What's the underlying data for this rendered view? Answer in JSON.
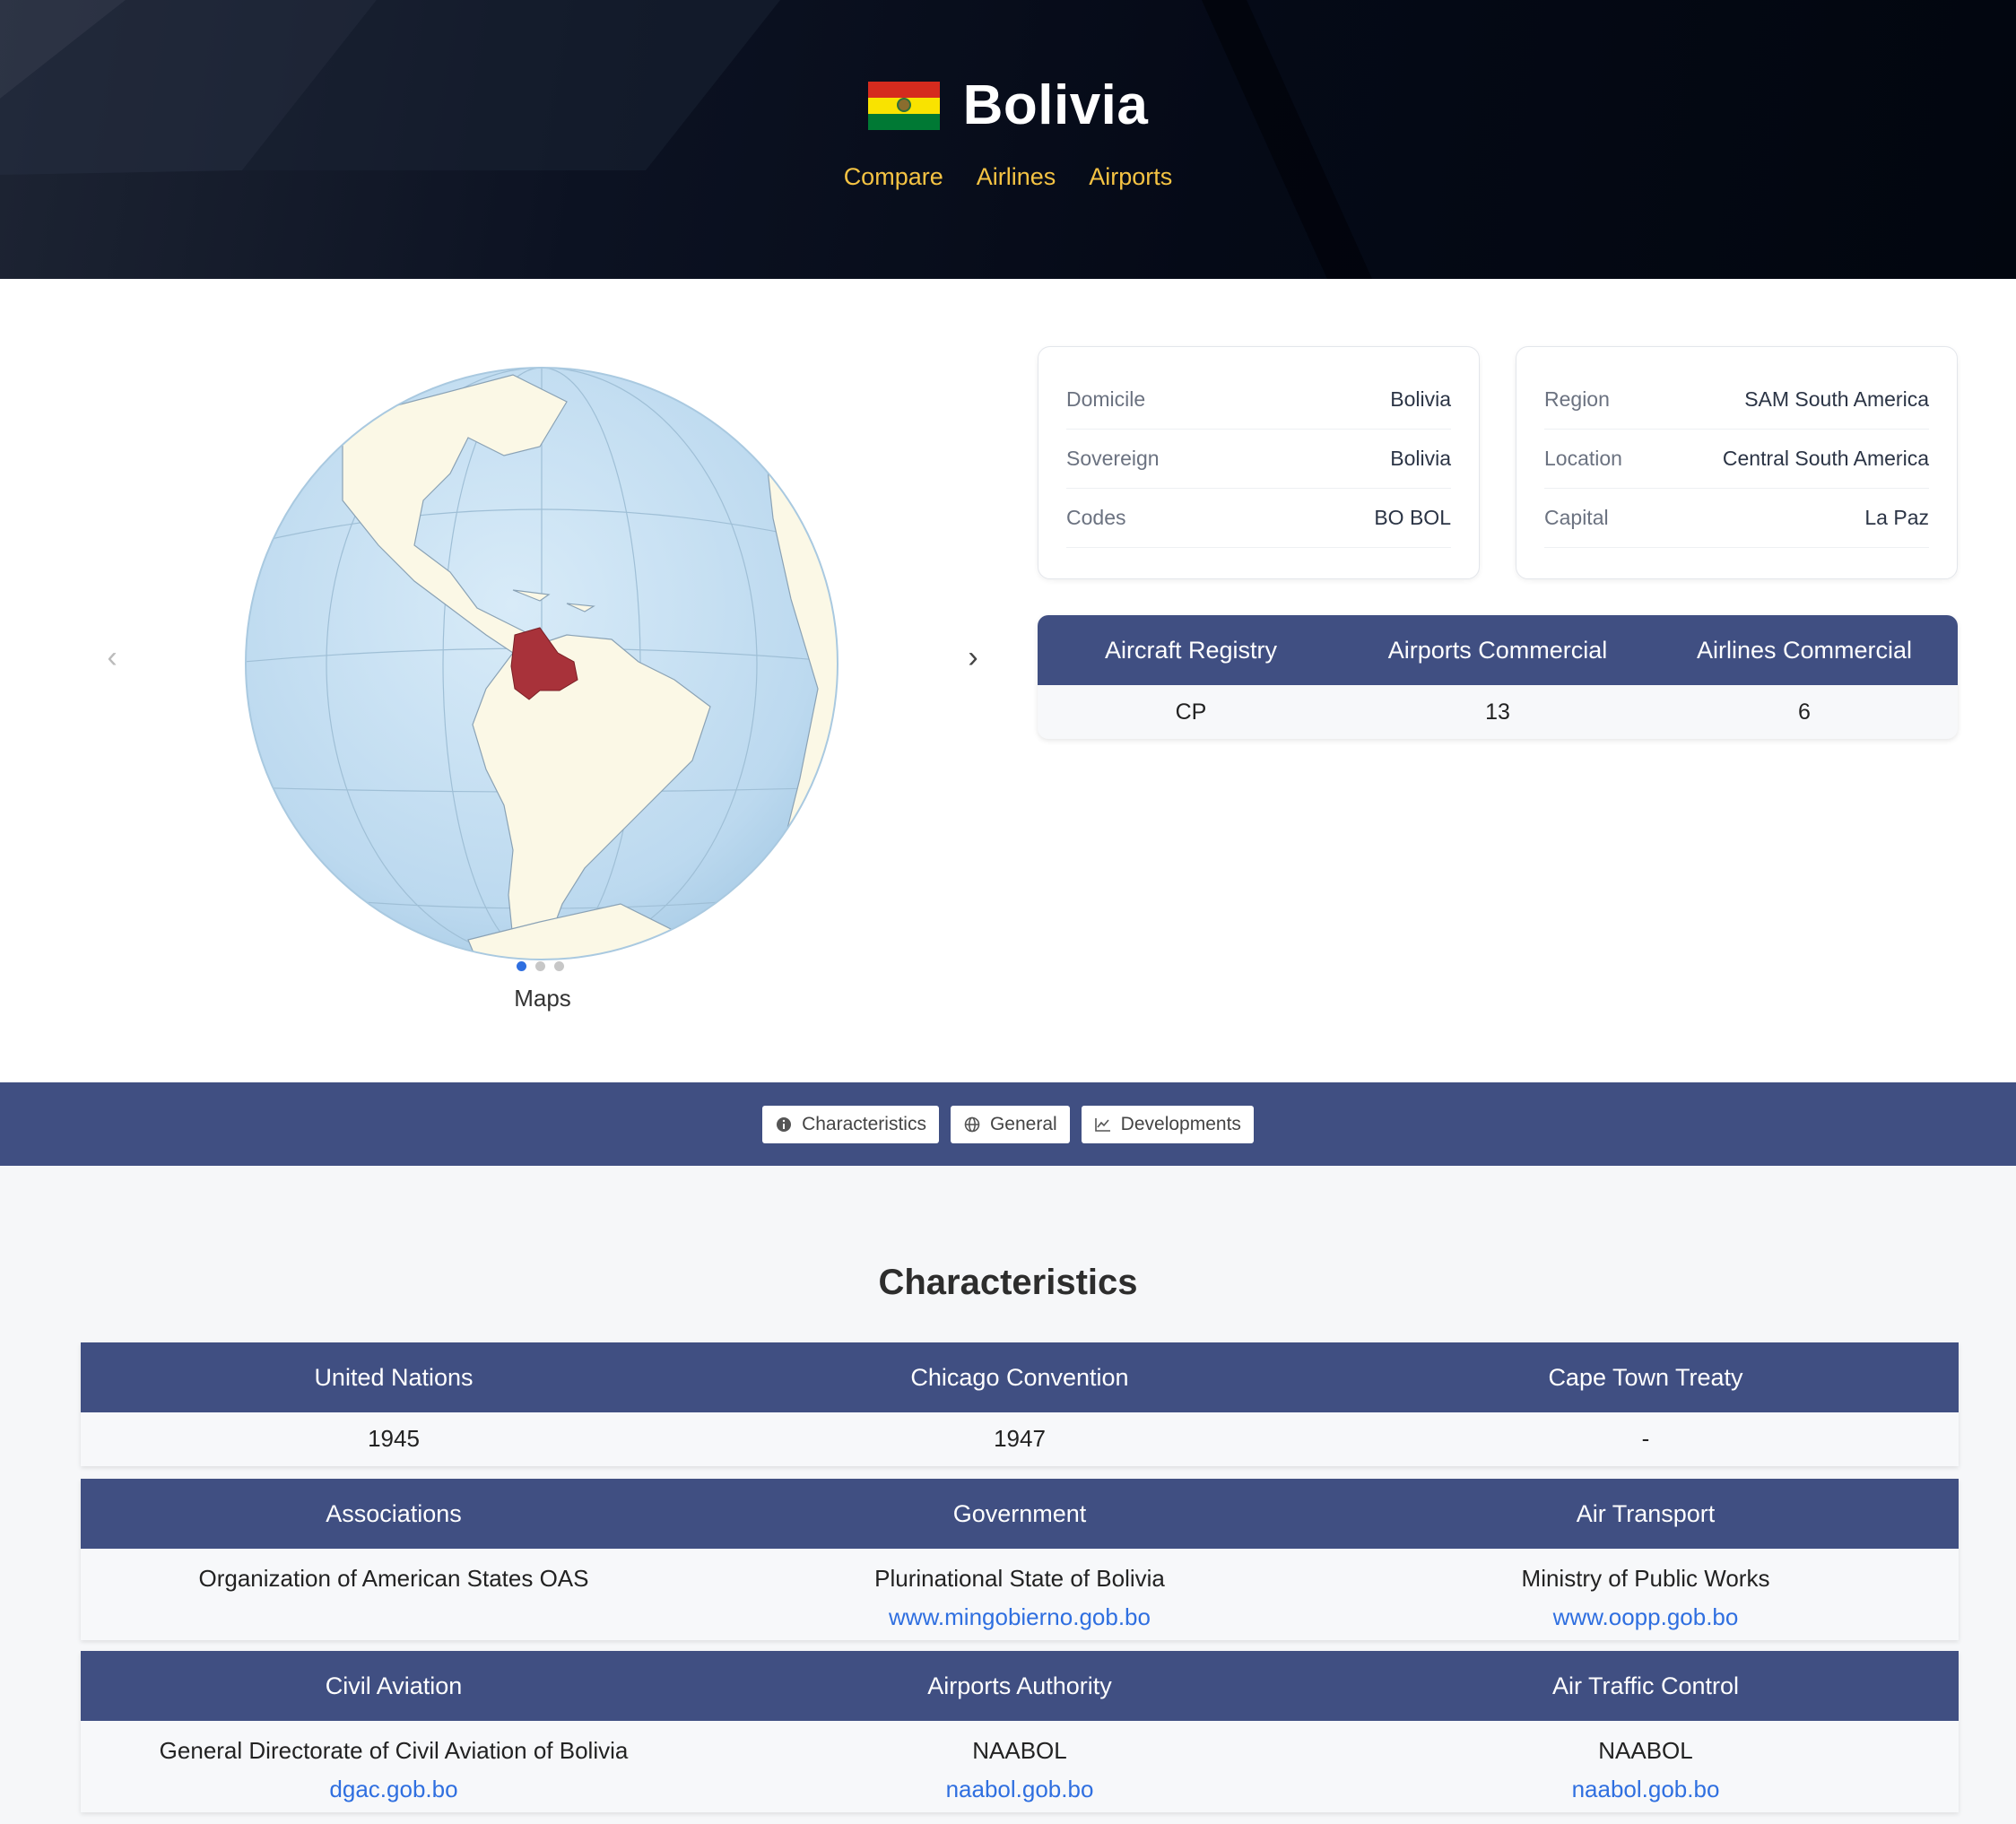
{
  "country": "Bolivia",
  "hero_nav": [
    "Compare",
    "Airlines",
    "Airports"
  ],
  "flag_colors": [
    "#d52b1e",
    "#f9e300",
    "#007934"
  ],
  "carousel": {
    "caption": "Maps",
    "slide_count": 3,
    "active_slide": 1,
    "prev_icon": "chevron-left-icon",
    "next_icon": "chevron-right-icon"
  },
  "card1": [
    {
      "label": "Domicile",
      "value": "Bolivia"
    },
    {
      "label": "Sovereign",
      "value": "Bolivia"
    },
    {
      "label": "Codes",
      "value": "BO BOL"
    }
  ],
  "card2": [
    {
      "label": "Region",
      "value": "SAM South America"
    },
    {
      "label": "Location",
      "value": "Central South America"
    },
    {
      "label": "Capital",
      "value": "La Paz"
    }
  ],
  "stats": {
    "headers": [
      "Aircraft Registry",
      "Airports Commercial",
      "Airlines Commercial"
    ],
    "values": [
      "CP",
      "13",
      "6"
    ]
  },
  "tabs": [
    {
      "label": "Characteristics",
      "icon": "info-icon"
    },
    {
      "label": "General",
      "icon": "globe-icon"
    },
    {
      "label": "Developments",
      "icon": "line-chart-icon"
    }
  ],
  "characteristics": {
    "title": "Characteristics",
    "tables": [
      {
        "headers": [
          "United Nations",
          "Chicago Convention",
          "Cape Town Treaty"
        ],
        "cells": [
          {
            "text": "1945",
            "link": ""
          },
          {
            "text": "1947",
            "link": ""
          },
          {
            "text": "-",
            "link": ""
          }
        ]
      },
      {
        "headers": [
          "Associations",
          "Government",
          "Air Transport"
        ],
        "cells": [
          {
            "text": "Organization of American States OAS",
            "link": ""
          },
          {
            "text": "Plurinational State of Bolivia",
            "link": "www.mingobierno.gob.bo"
          },
          {
            "text": "Ministry of Public Works",
            "link": "www.oopp.gob.bo"
          }
        ]
      },
      {
        "headers": [
          "Civil Aviation",
          "Airports Authority",
          "Air Traffic Control"
        ],
        "cells": [
          {
            "text": "General Directorate of Civil Aviation of Bolivia",
            "link": "dgac.gob.bo"
          },
          {
            "text": "NAABOL",
            "link": "naabol.gob.bo"
          },
          {
            "text": "NAABOL",
            "link": "naabol.gob.bo"
          }
        ]
      }
    ]
  },
  "colors": {
    "header_bar": "#404f82",
    "link": "#2f6fe0",
    "hero_nav": "#f5c343",
    "highlight": "#a8323a"
  }
}
